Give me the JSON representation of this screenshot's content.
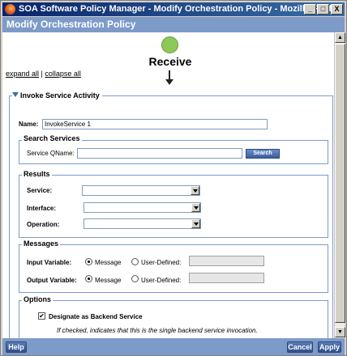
{
  "window": {
    "title": "SOA Software Policy Manager - Modify Orchestration Policy - Mozilla Firefox",
    "minimize_glyph": "_",
    "maximize_glyph": "□",
    "close_glyph": "X"
  },
  "app": {
    "title": "Modify Orchestration Policy"
  },
  "diagram": {
    "node_label": "Receive",
    "node_color": "#8dc859"
  },
  "links": {
    "expand_all": "expand all",
    "separator": " | ",
    "collapse_all": "collapse all"
  },
  "activity": {
    "legend": "Invoke Service Activity",
    "name_label": "Name:",
    "name_value": "InvokeService 1"
  },
  "search_services": {
    "legend": "Search Services",
    "qname_label": "Service QName:",
    "qname_value": "",
    "search_button": "Search"
  },
  "results": {
    "legend": "Results",
    "service_label": "Service:",
    "service_value": "",
    "interface_label": "Interface:",
    "interface_value": "",
    "operation_label": "Operation:",
    "operation_value": ""
  },
  "messages": {
    "legend": "Messages",
    "input_label": "Input Variable:",
    "output_label": "Output Variable:",
    "message_option": "Message",
    "user_defined_option": "User-Defined:",
    "input_selected": "Message",
    "output_selected": "Message",
    "input_user_value": "",
    "output_user_value": ""
  },
  "options": {
    "legend": "Options",
    "backend_label": "Designate as Backend Service",
    "backend_checked": true,
    "backend_check_glyph": "✔",
    "backend_note": "If checked, indicates that this is the single backend service invocation."
  },
  "footer": {
    "help": "Help",
    "cancel": "Cancel",
    "apply": "Apply"
  },
  "scrollbar": {
    "up_glyph": "▲",
    "down_glyph": "▼"
  },
  "colors": {
    "title_bar": "#0a246a",
    "app_header": "#7d9bc9",
    "fieldset_border": "#7b9bd0",
    "button_blue": "#3a5f9e"
  }
}
